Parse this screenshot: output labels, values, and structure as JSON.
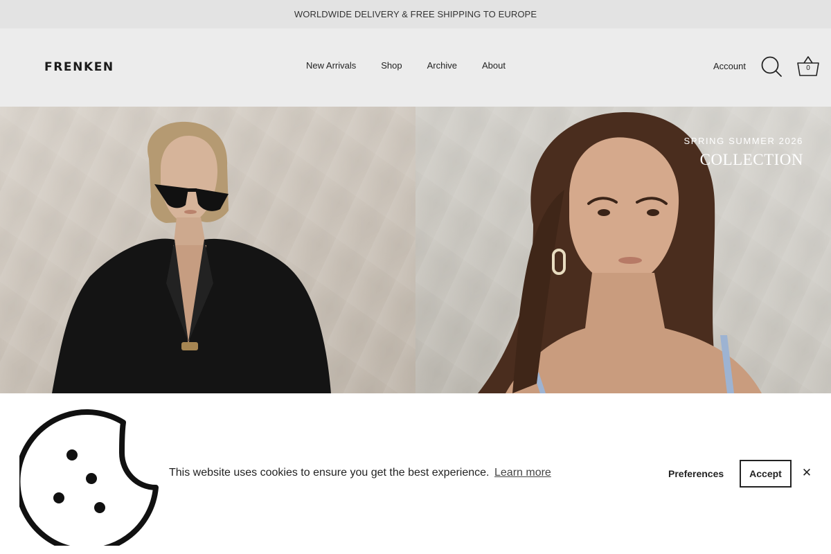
{
  "announcement": {
    "text": "WORLDWIDE DELIVERY & FREE SHIPPING TO EUROPE"
  },
  "header": {
    "logo": "FRENKEN",
    "nav": [
      {
        "label": "New Arrivals"
      },
      {
        "label": "Shop"
      },
      {
        "label": "Archive"
      },
      {
        "label": "About"
      }
    ],
    "account_label": "Account",
    "search_icon": "search-icon",
    "cart_icon": "basket-icon",
    "cart_count": "0"
  },
  "hero": {
    "subtitle": "SPRING SUMMER 2026",
    "title": "COLLECTION"
  },
  "cookie_banner": {
    "icon": "cookie-icon",
    "message": "This website uses cookies to ensure you get the best experience.",
    "learn_more": "Learn more",
    "preferences": "Preferences",
    "accept": "Accept",
    "close": "✕"
  },
  "colors": {
    "announcement_bg": "#e3e3e3",
    "header_bg": "#ececec",
    "banner_bg": "#ffffff",
    "text": "#222222",
    "hero_text": "#ffffff"
  }
}
